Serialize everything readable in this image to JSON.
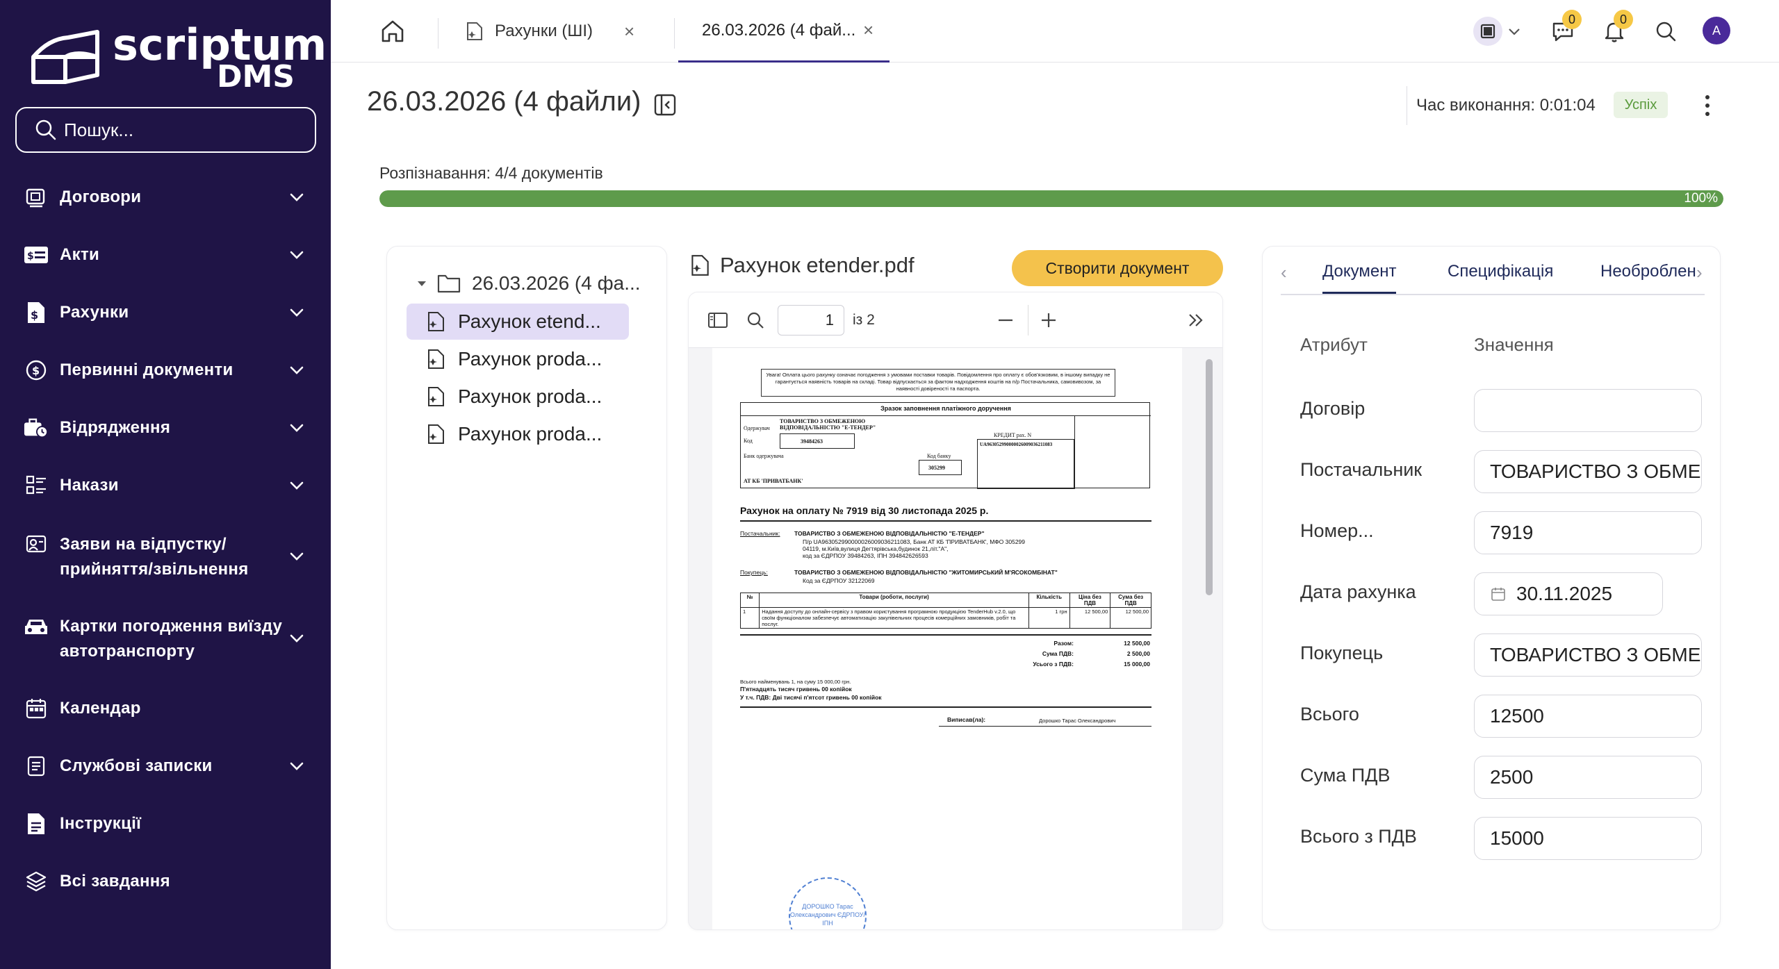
{
  "app": {
    "brand_word": "scriptum",
    "brand_sub": "DMS"
  },
  "search": {
    "label": "Пошук..."
  },
  "sidebar": {
    "items": [
      {
        "label": "Договори",
        "icon": "contract-icon",
        "has_chevron": true
      },
      {
        "label": "Акти",
        "icon": "act-icon",
        "has_chevron": true
      },
      {
        "label": "Рахунки",
        "icon": "invoice-icon",
        "has_chevron": true
      },
      {
        "label": "Первинні документи",
        "icon": "coin-icon",
        "has_chevron": true
      },
      {
        "label": "Відрядження",
        "icon": "travel-icon",
        "has_chevron": true
      },
      {
        "label": "Накази",
        "icon": "orders-icon",
        "has_chevron": true
      },
      {
        "label": "Заяви на відпустку/ прийняття/звільнення",
        "icon": "hr-icon",
        "has_chevron": true
      },
      {
        "label": "Картки погодження виїзду автотранспорту",
        "icon": "car-icon",
        "has_chevron": true
      },
      {
        "label": "Календар",
        "icon": "calendar-icon",
        "has_chevron": false
      },
      {
        "label": "Службові записки",
        "icon": "memo-icon",
        "has_chevron": true
      },
      {
        "label": "Інструкції",
        "icon": "instructions-icon",
        "has_chevron": false
      },
      {
        "label": "Всі завдання",
        "icon": "layers-icon",
        "has_chevron": false
      }
    ]
  },
  "tabs": [
    {
      "label": "Рахунки (ШІ)"
    },
    {
      "label": "26.03.2026 (4 фай..."
    }
  ],
  "notifications": {
    "messages_count": "0",
    "alerts_count": "0",
    "avatar_letter": "A"
  },
  "header": {
    "title": "26.03.2026 (4 файли)",
    "exec_time": "Час виконання: 0:01:04",
    "status": "Успіх"
  },
  "progress": {
    "label": "Розпізнавання: 4/4 документів",
    "value": 1.0,
    "percent_text": "100%"
  },
  "tree": {
    "root": "26.03.2026 (4 фа...",
    "files": [
      {
        "label": "Рахунок etend..."
      },
      {
        "label": "Рахунок proda..."
      },
      {
        "label": "Рахунок proda..."
      },
      {
        "label": "Рахунок proda..."
      }
    ]
  },
  "viewer": {
    "filename": "Рахунок etender.pdf",
    "create_button": "Створити документ",
    "page_current": "1",
    "page_of": "із 2"
  },
  "doc": {
    "notice": "Увага! Оплата цього рахунку означає погодження з умовами поставки товарів. Повідомлення про оплату є обов'язковим, в іншому випадку не гарантується наявність товарів на складі. Товар відпускається за фактом надходження коштів на п/р Постачальника, самовивозом, за наявності довіреності та паспорта.",
    "form_title": "Зразок заповнення платіжного доручення",
    "recipient": "ТОВАРИСТВО З ОБМЕЖЕНОЮ ВІДПОВІДАЛЬНІСТЮ \"Е-ТЕНДЕР\"",
    "recipient_label": "Одержувач",
    "code_label": "Код",
    "code": "39484263",
    "bank_label": "Банк одержувача",
    "bank": "АТ КБ 'ПРИВАТБАНК'",
    "bank_code_label": "Код банку",
    "bank_code": "305299",
    "credit_label": "КРЕДИТ рах. N",
    "iban": "UA963052990000026009036211083",
    "invoice_title": "Рахунок на оплату № 7919 від 30 листопада 2025 р.",
    "supplier_label": "Постачальник:",
    "supplier": "ТОВАРИСТВО З ОБМЕЖЕНОЮ ВІДПОВІДАЛЬНІСТЮ \"Е-ТЕНДЕР\"",
    "supplier_l2": "П/р UA963052990000026009036211083, Банк АТ КБ 'ПРИВАТБАНК', МФО 305299",
    "supplier_l3": "04119, м.Київ,вулиця Дегтярівська,будинок 21,літ.\"А\",",
    "supplier_l4": "код за ЄДРПОУ 39484263, ІПН 394842626593",
    "buyer_label": "Покупець:",
    "buyer": "ТОВАРИСТВО З ОБМЕЖЕНОЮ ВІДПОВІДАЛЬНІСТЮ \"ЖИТОМИРСЬКИЙ М'ЯСОКОМБІНАТ\"",
    "buyer_l2": "Код за ЄДРПОУ 32122069",
    "th_no": "№",
    "th_goods": "Товари (роботи, послуги)",
    "th_qty": "Кількість",
    "th_price": "Ціна без ПДВ",
    "th_sum": "Сума без ПДВ",
    "row_no": "1",
    "row_goods": "Надання доступу до онлайн-сервісу з правом користування програмною продукцією TenderHub v.2.0, що своїм функціоналом забезпечує автоматизацію закупівельних процесів комерційних замовників, робіт та послуг.",
    "row_qty": "1",
    "row_unit": "грн",
    "row_price": "12 500,00",
    "row_sum": "12 500,00",
    "total_label": "Разом:",
    "total": "12 500,00",
    "vat_label": "Сума ПДВ:",
    "vat": "2 500,00",
    "grand_label": "Усього з ПДВ:",
    "grand": "15 000,00",
    "items_note": "Всього найменувань 1, на суму 15 000,00 грн.",
    "words1": "П'ятнадцять тисяч гривень 00 копійок",
    "words2": "У т.ч. ПДВ: Дві тисячі п'ятсот гривень 00 копійок",
    "signed_label": "Виписав(ла):",
    "signer": "Дорошко Тарас Олександрович",
    "stamp": "ДОРОШКО Тарас Олександрович ЄДРПОУ/ІПН"
  },
  "attrs": {
    "tabs": [
      "Документ",
      "Специфікація",
      "Необроблен"
    ],
    "col_attr": "Атрибут",
    "col_value": "Значення",
    "fields": [
      {
        "label": "Договір",
        "value": ""
      },
      {
        "label": "Постачальник",
        "value": "ТОВАРИСТВО З ОБМЕ"
      },
      {
        "label": "Номер...",
        "value": "7919"
      },
      {
        "label": "Дата рахунка",
        "value": "30.11.2025"
      },
      {
        "label": "Покупець",
        "value": "ТОВАРИСТВО З ОБМЕ"
      },
      {
        "label": "Всього",
        "value": "12500"
      },
      {
        "label": "Сума ПДВ",
        "value": "2500"
      },
      {
        "label": "Всього з ПДВ",
        "value": "15000"
      }
    ]
  },
  "colors": {
    "sidebar_bg": "#1f1446",
    "accent": "#3a2d8a",
    "button": "#f4c24c",
    "progress": "#5e9b4b",
    "success": "#5a9a3c"
  }
}
